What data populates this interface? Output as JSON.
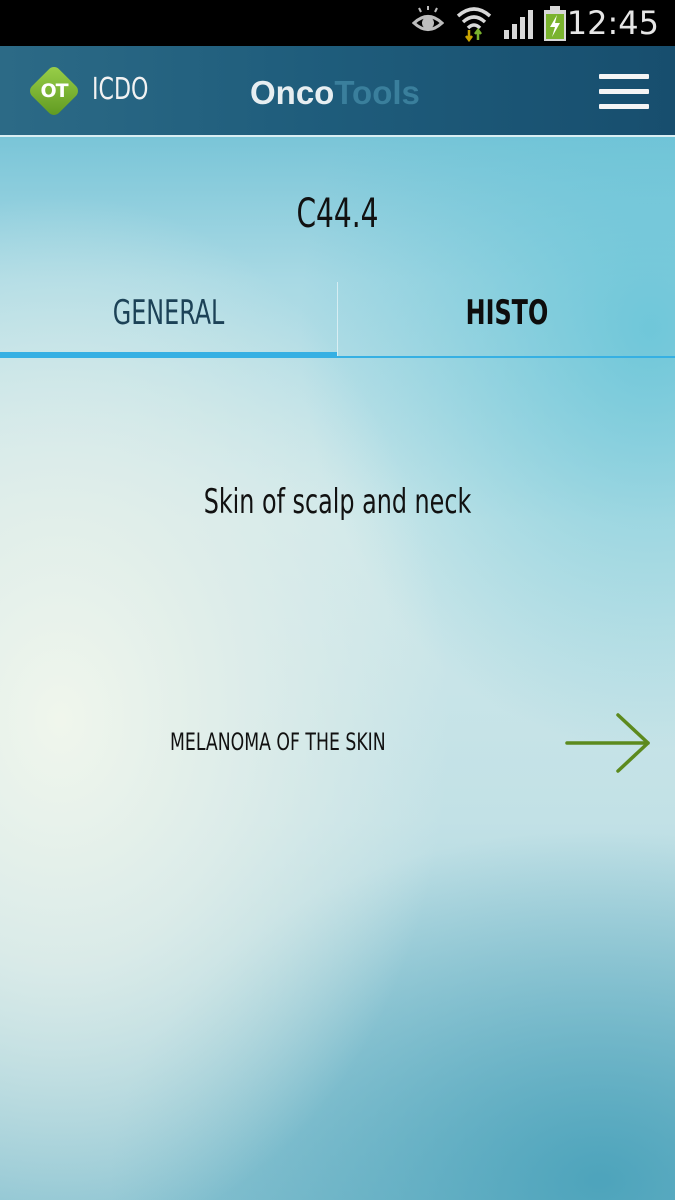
{
  "status_bar": {
    "time": "12:45",
    "icons": [
      "eye-icon",
      "wifi-icon",
      "signal-icon",
      "battery-charging-icon"
    ]
  },
  "app_bar": {
    "logo_text": "OT",
    "app_name": "ICDO",
    "brand_part1": "Onco",
    "brand_part2": "Tools",
    "menu_icon": "hamburger-menu-icon"
  },
  "code": "C44.4",
  "tabs": [
    {
      "label": "GENERAL",
      "selected": true
    },
    {
      "label": "HISTO",
      "selected": false
    }
  ],
  "content": {
    "site_description": "Skin of scalp and neck",
    "link_label": "MELANOMA OF THE SKIN",
    "link_icon": "arrow-right-icon"
  },
  "colors": {
    "accent": "#36b0e3",
    "logo_green": "#7ab32e",
    "arrow_green": "#5c8a1e"
  }
}
